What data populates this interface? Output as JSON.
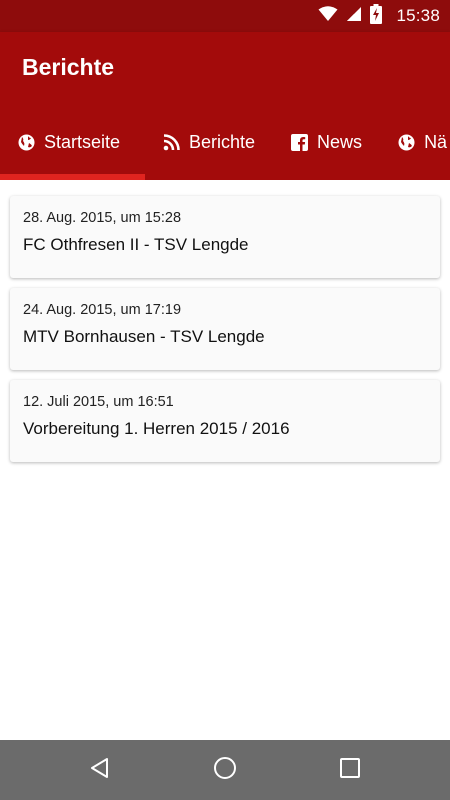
{
  "status_bar": {
    "time": "15:38",
    "icons": [
      "wifi-icon",
      "cell-signal-icon",
      "battery-charging-icon"
    ]
  },
  "app_bar": {
    "title": "Berichte",
    "color": "#a30b0b",
    "accent": "#e0241f"
  },
  "tabs": [
    {
      "label": "Startseite",
      "icon": "globe-icon",
      "selected": true
    },
    {
      "label": "Berichte",
      "icon": "rss-icon",
      "selected": false
    },
    {
      "label": "News",
      "icon": "facebook-icon",
      "selected": false
    },
    {
      "label": "Nä",
      "icon": "globe-icon",
      "selected": false
    }
  ],
  "reports": [
    {
      "date": "28. Aug. 2015, um 15:28",
      "title": "FC Othfresen II - TSV Lengde"
    },
    {
      "date": "24. Aug. 2015, um 17:19",
      "title": "MTV Bornhausen - TSV Lengde"
    },
    {
      "date": "12. Juli 2015, um 16:51",
      "title": "Vorbereitung 1. Herren 2015 / 2016"
    }
  ],
  "nav_bar": {
    "buttons": [
      "back-icon",
      "home-icon",
      "recents-icon"
    ]
  }
}
